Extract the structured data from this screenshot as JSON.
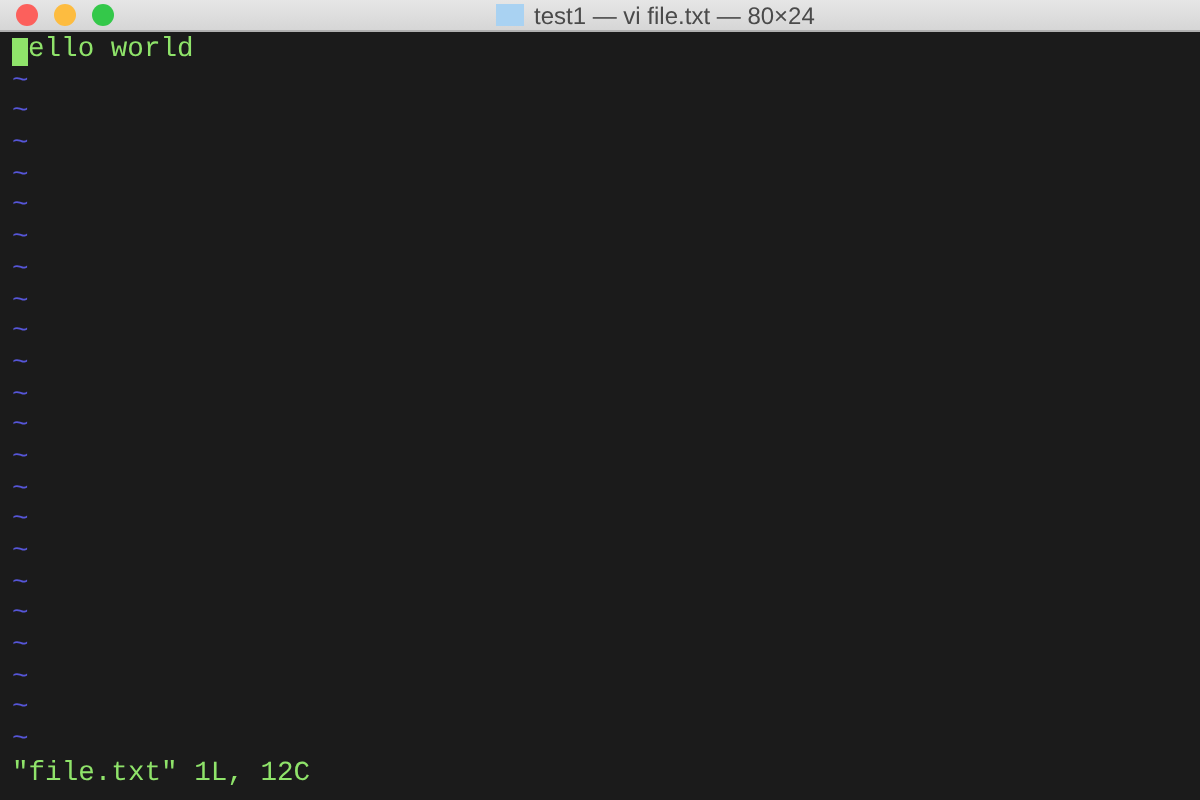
{
  "window": {
    "title": "test1 — vi file.txt — 80×24"
  },
  "buffer": [
    {
      "text": "ello world",
      "cursor": true
    }
  ],
  "empty_lines": [
    "~",
    "~",
    "~",
    "~",
    "~",
    "~",
    "~",
    "~",
    "~",
    "~",
    "~",
    "~",
    "~",
    "~",
    "~",
    "~",
    "~",
    "~",
    "~",
    "~",
    "~",
    "~"
  ],
  "status_line": "\"file.txt\" 1L, 12C"
}
